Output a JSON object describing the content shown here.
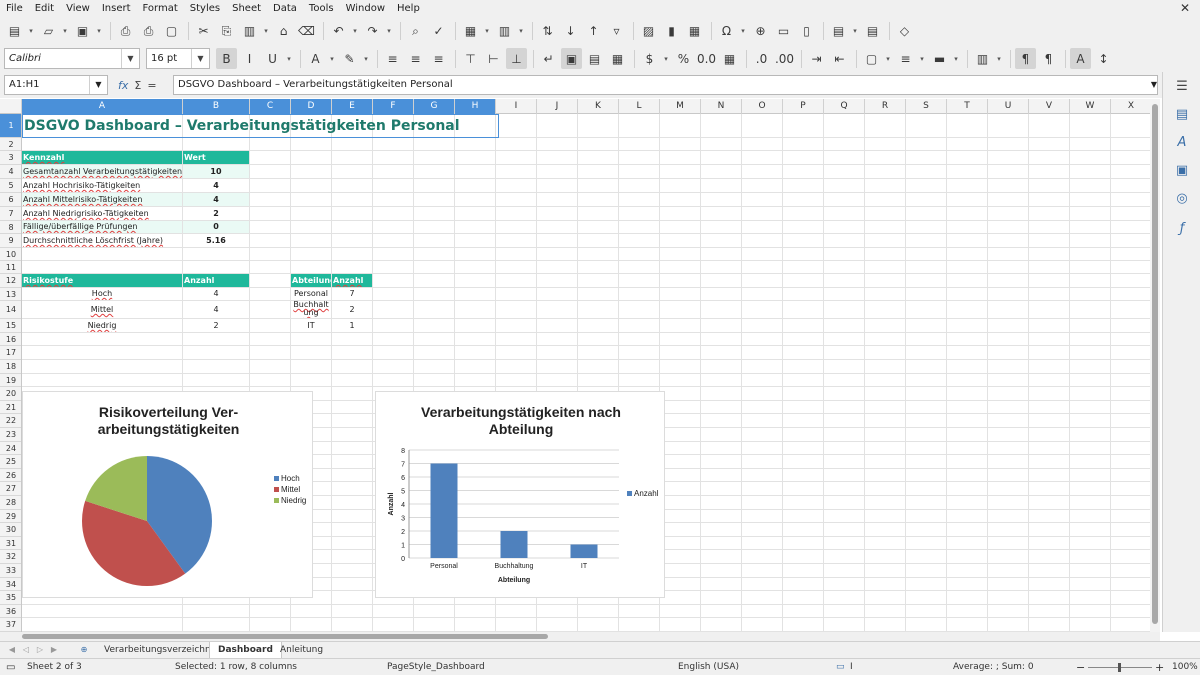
{
  "menubar": {
    "items": [
      "File",
      "Edit",
      "View",
      "Insert",
      "Format",
      "Styles",
      "Sheet",
      "Data",
      "Tools",
      "Window",
      "Help"
    ],
    "close": "✕"
  },
  "formatting": {
    "font_name": "Calibri",
    "font_size": "16 pt"
  },
  "formula_bar": {
    "name_box": "A1:H1",
    "fx": "fx",
    "sigma": "Σ",
    "equals": "=",
    "content": "DSGVO Dashboard – Verarbeitungstätigkeiten Personal"
  },
  "columns": [
    "A",
    "B",
    "C",
    "D",
    "E",
    "F",
    "G",
    "H",
    "I",
    "J",
    "K",
    "L",
    "M",
    "N",
    "O",
    "P",
    "Q",
    "R",
    "S",
    "T",
    "U",
    "V",
    "W",
    "X"
  ],
  "rows": [
    "1",
    "2",
    "3",
    "4",
    "5",
    "6",
    "7",
    "8",
    "9",
    "10",
    "11",
    "12",
    "13",
    "14",
    "15",
    "16",
    "17",
    "18",
    "19",
    "20",
    "21",
    "22",
    "23",
    "24",
    "25",
    "26",
    "27",
    "28",
    "29",
    "30",
    "31",
    "32",
    "33",
    "34",
    "35",
    "36",
    "37"
  ],
  "sheet": {
    "title": "DSGVO Dashboard – Verarbeitungstätigkeiten Personal",
    "kpi": {
      "header_label": "Kennzahl",
      "header_value": "Wert",
      "rows": [
        {
          "label": "Gesamtanzahl Verarbeitungstätigkeiten",
          "value": "10"
        },
        {
          "label": "Anzahl Hochrisiko-Tätigkeiten",
          "value": "4"
        },
        {
          "label": "Anzahl Mittelrisiko-Tätigkeiten",
          "value": "4"
        },
        {
          "label": "Anzahl Niedrigrisiko-Tätigkeiten",
          "value": "2"
        },
        {
          "label": "Fällige/überfällige Prüfungen",
          "value": "0"
        },
        {
          "label": "Durchschnittliche Löschfrist (Jahre)",
          "value": "5.16"
        }
      ]
    },
    "risk": {
      "header_label": "Risikostufe",
      "header_value": "Anzahl",
      "rows": [
        {
          "label": "Hoch",
          "value": "4"
        },
        {
          "label": "Mittel",
          "value": "4"
        },
        {
          "label": "Niedrig",
          "value": "2"
        }
      ]
    },
    "dept": {
      "header_label": "Abteilung",
      "header_value": "Anzahl",
      "rows": [
        {
          "label": "Personal",
          "value": "7"
        },
        {
          "label": "Buchhaltung",
          "value": "2"
        },
        {
          "label": "IT",
          "value": "1"
        }
      ]
    }
  },
  "chart_data": [
    {
      "type": "pie",
      "title": "Risikoverteilung Verarbeitungstätigkeiten",
      "title_lines": [
        "Risikoverteilung Ver-",
        "arbeitungstätigkeiten"
      ],
      "categories": [
        "Hoch",
        "Mittel",
        "Niedrig"
      ],
      "values": [
        4,
        4,
        2
      ],
      "colors": [
        "#4f81bd",
        "#c0504d",
        "#9bbb59"
      ],
      "legend": "right"
    },
    {
      "type": "bar",
      "title": "Verarbeitungstätigkeiten nach Abteilung",
      "title_lines": [
        "Verarbeitungstätigkeiten nach",
        "Abteilung"
      ],
      "categories": [
        "Personal",
        "Buchhaltung",
        "IT"
      ],
      "series": [
        {
          "name": "Anzahl",
          "values": [
            7,
            2,
            1
          ],
          "color": "#4f81bd"
        }
      ],
      "xlabel": "Abteilung",
      "ylabel": "Anzahl",
      "ylim": [
        0,
        8
      ],
      "yticks": [
        "0",
        "1",
        "2",
        "3",
        "4",
        "5",
        "6",
        "7",
        "8"
      ],
      "grid": true,
      "legend": "right"
    }
  ],
  "tabs": {
    "items": [
      "Verarbeitungsverzeichnis",
      "Dashboard",
      "Anleitung"
    ],
    "active": "Dashboard"
  },
  "status": {
    "sheet": "Sheet 2 of 3",
    "selection": "Selected: 1 row, 8 columns",
    "page_style": "PageStyle_Dashboard",
    "language": "English (USA)",
    "sum": "Average: ; Sum: 0",
    "zoom": "100%",
    "zoom_minus": "−",
    "zoom_plus": "+"
  }
}
